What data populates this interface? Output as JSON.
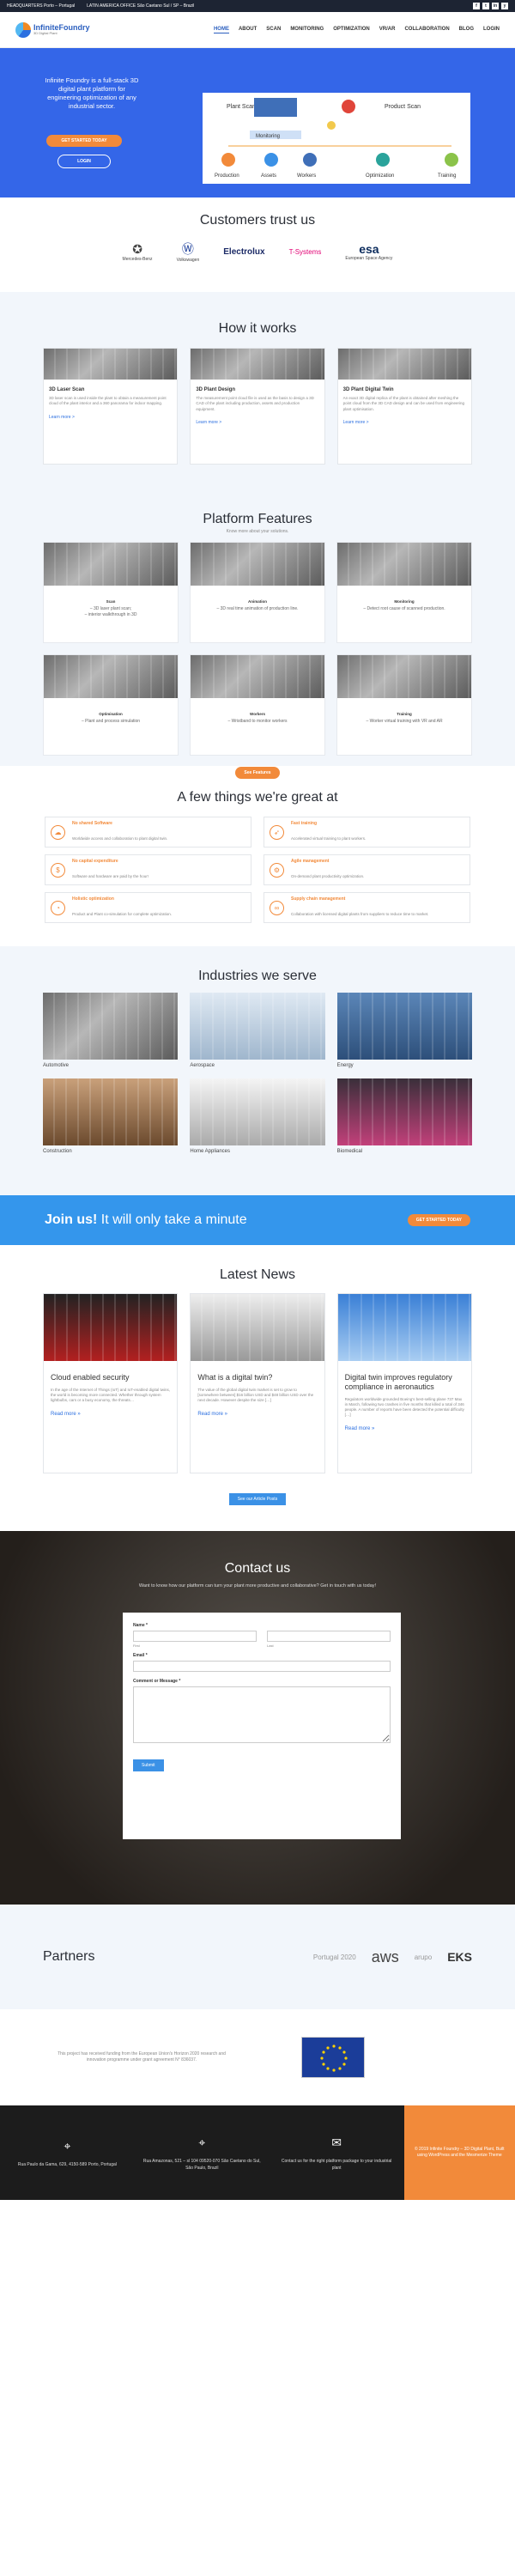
{
  "topbar": {
    "hq": "HEADQUARTERS Porto – Portugal",
    "latam": "LATIN AMERICA OFFICE São Caetano Sul / SP – Brazil",
    "social": [
      "f",
      "t",
      "in",
      "y"
    ]
  },
  "brand": {
    "name": "InfiniteFoundry",
    "tagline": "3D Digital Plant"
  },
  "nav": [
    "HOME",
    "ABOUT",
    "SCAN",
    "MONITORING",
    "OPTIMIZATION",
    "VR/AR",
    "COLLABORATION",
    "BLOG",
    "LOGIN"
  ],
  "hero": {
    "text": "Infinite Foundry is a full-stack 3D digital plant platform for engineering optimization of any industrial sector.",
    "cta": "GET STARTED TODAY",
    "login": "LOGIN",
    "diagram": {
      "plant_scan": "Plant Scan",
      "product_scan": "Product Scan",
      "monitoring": "Monitoring",
      "leaves": [
        "Production",
        "Assets",
        "Workers",
        "Optimization",
        "Training"
      ]
    }
  },
  "customers": {
    "title": "Customers trust us",
    "logos": [
      {
        "name": "Mercedes-Benz"
      },
      {
        "name": "Volkswagen"
      },
      {
        "name": "Electrolux"
      },
      {
        "name": "T-Systems"
      },
      {
        "name": "esa",
        "sub": "European Space Agency"
      }
    ]
  },
  "how": {
    "title": "How it works",
    "cards": [
      {
        "title": "3D Laser Scan",
        "text": "3D laser scan is used inside the plant to obtain a measurement point cloud of the plant interior and a 360 panorama for indoor mapping.",
        "link": "Learn more >"
      },
      {
        "title": "3D Plant Design",
        "text": "The measurement point cloud file is used as the basis to design a 3D CAD of the plant including production, assets and production equipment.",
        "link": "Learn more >"
      },
      {
        "title": "3D Plant Digital Twin",
        "text": "An exact 3D digital replica of the plant is obtained after meshing the point cloud from the 3D CAD design and can be used from engineering plant optimisation.",
        "link": "Learn more >"
      }
    ]
  },
  "features": {
    "title": "Platform Features",
    "subtitle": "Know more about your solutions.",
    "items": [
      {
        "title": "Scan",
        "text": "– 3D laser plant scan;\n– interior walkthrough in 3D"
      },
      {
        "title": "Animation",
        "text": "– 3D real time animation of production line."
      },
      {
        "title": "Monitoring",
        "text": "– Detect root cause of scanned production."
      },
      {
        "title": "Optimisation",
        "text": "– Plant and process simulation"
      },
      {
        "title": "Workers",
        "text": "– Wristband to monitor workers"
      },
      {
        "title": "Training",
        "text": "– Worker virtual training with VR and AR"
      }
    ],
    "button": "See Features"
  },
  "great": {
    "title": "A few things we're great at",
    "items": [
      {
        "title": "No shared Software",
        "text": "Worldwide access and collaboration to plant digital twin.",
        "icon": "cloud-icon"
      },
      {
        "title": "Fast training",
        "text": "Accelerated virtual training to plant workers.",
        "icon": "rocket-icon"
      },
      {
        "title": "No capital expenditure",
        "text": "Software and hardware are paid by the hour!",
        "icon": "money-icon"
      },
      {
        "title": "Agile management",
        "text": "On-demand plant productivity optimization.",
        "icon": "gear-icon"
      },
      {
        "title": "Holistic optimization",
        "text": "Product and Plant co-simulation for complete optimization.",
        "icon": "pie-icon"
      },
      {
        "title": "Supply chain management",
        "text": "Collaboration with licensed digital plants from suppliers to reduce time to market.",
        "icon": "link-icon"
      }
    ]
  },
  "industries": {
    "title": "Industries we serve",
    "items": [
      "Automotive",
      "Aerospace",
      "Energy",
      "Construction",
      "Home Appliances",
      "Biomedical"
    ]
  },
  "join": {
    "lead": "Join us!",
    "text": "It will only take a minute",
    "button": "GET STARTED TODAY"
  },
  "news": {
    "title": "Latest News",
    "items": [
      {
        "title": "Cloud enabled security",
        "text": "In the age of the Internet of Things (IoT) and IoT-enabled digital twins, the world is becoming more connected. Whether through system lightbulbs, cars or a busy economy, the threats…",
        "link": "Read more »"
      },
      {
        "title": "What is a digital twin?",
        "text": "The value of the global digital twin market is set to grow to [somewhere between] $16 billion USD and $48 billion USD over the next decade. However despite the size […]",
        "link": "Read more »"
      },
      {
        "title": "Digital twin improves regulatory compliance in aeronautics",
        "text": "Regulators worldwide grounded Boeing's best-selling plane 737 Max in March, following two crashes in five months that killed a total of 346 people. A number of reports have been detected the potential difficulty […]",
        "link": "Read more »"
      }
    ],
    "button": "See our Article Posts"
  },
  "contact": {
    "title": "Contact us",
    "subtitle": "Want to know how our platform can turn your plant more productive and collaborative? Get in touch with us today!",
    "name_label": "Name *",
    "first": "First",
    "last": "Last",
    "email_label": "Email *",
    "comment_label": "Comment or Message *",
    "submit": "Submit"
  },
  "partners": {
    "title": "Partners",
    "logos": [
      "Portugal 2020",
      "aws",
      "arupo",
      "EKS"
    ]
  },
  "eu": {
    "text": "This project has received funding from the European Union's Horizon 2020 research and innovation programme under grant agreement N° 836037."
  },
  "footer": {
    "addr1": "Rua Paulo da Gama, 629, 4150-589 Porto, Portugal",
    "addr2": "Rua Amazonas, 521 – sl 104 09520-070 São Caetano do Sul, São Paulo, Brazil",
    "contact": "Contact us for the right platform package to your industrial plant",
    "copyright": "© 2019 Infinite Foundry – 3D Digital Plant, Built using WordPress and the Mesmerize Theme"
  }
}
